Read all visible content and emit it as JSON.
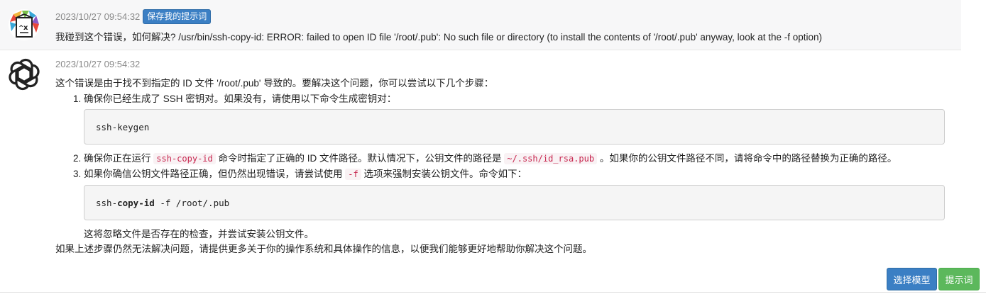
{
  "user_message": {
    "timestamp": "2023/10/27 09:54:32",
    "save_prompt_label": "保存我的提示词",
    "text": "我碰到这个错误，如何解决?  /usr/bin/ssh-copy-id: ERROR: failed to open ID file '/root/.pub': No such file or directory (to install the contents of '/root/.pub' anyway, look at the -f option)"
  },
  "bot_message": {
    "timestamp": "2023/10/27 09:54:32",
    "intro": "这个错误是由于找不到指定的 ID 文件 '/root/.pub' 导致的。要解决这个问题，你可以尝试以下几个步骤：",
    "step1": "确保你已经生成了 SSH 密钥对。如果没有，请使用以下命令生成密钥对：",
    "code1": "ssh-keygen",
    "step2_a": "确保你正在运行 ",
    "step2_code1": "ssh-copy-id",
    "step2_b": " 命令时指定了正确的 ID 文件路径。默认情况下，公钥文件的路径是 ",
    "step2_code2": "~/.ssh/id_rsa.pub",
    "step2_c": " 。如果你的公钥文件路径不同，请将命令中的路径替换为正确的路径。",
    "step3_a": "如果你确信公钥文件路径正确，但仍然出现错误，请尝试使用 ",
    "step3_code": "-f",
    "step3_b": " 选项来强制安装公钥文件。命令如下：",
    "code2_pre": "ssh-",
    "code2_bold": "copy-id",
    "code2_post": " -f /root/.pub",
    "note": "这将忽略文件是否存在的检查，并尝试安装公钥文件。",
    "closing": "如果上述步骤仍然无法解决问题，请提供更多关于你的操作系统和具体操作的信息，以便我们能够更好地帮助你解决这个问题。"
  },
  "buttons": {
    "select_model": "选择模型",
    "prompts": "提示词"
  },
  "icons": {
    "user_avatar": "app-logo-icon",
    "bot_avatar": "openai-logo-icon"
  }
}
